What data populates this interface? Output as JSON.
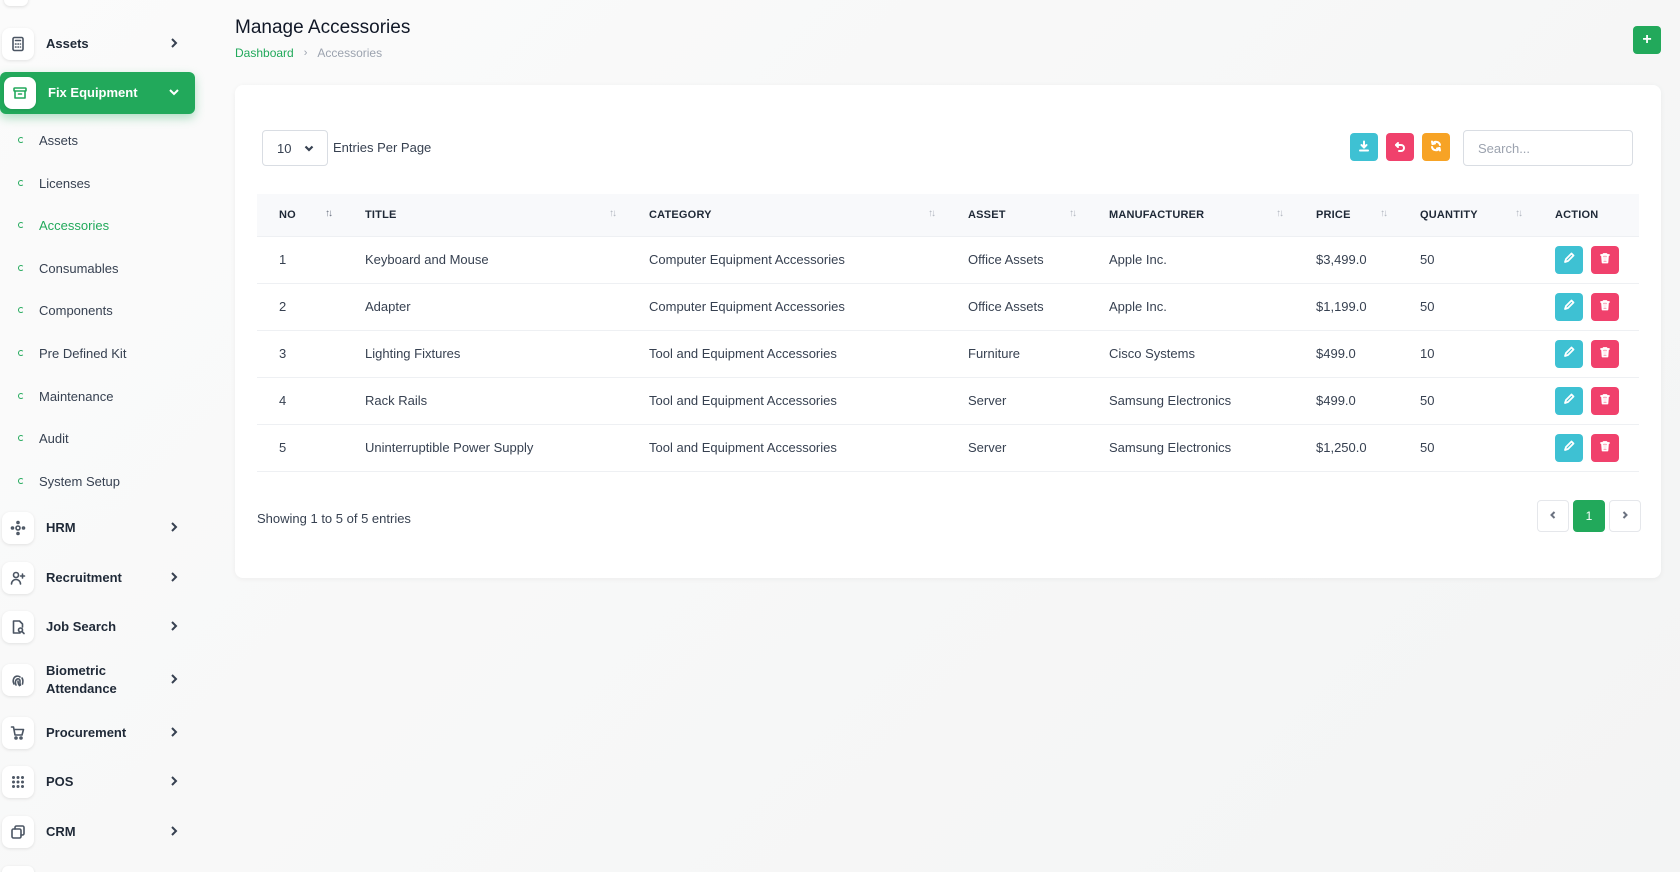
{
  "sidebar": {
    "groups": [
      {
        "label": "Assets",
        "icon": "calculator-icon"
      },
      {
        "label": "Fix Equipment",
        "icon": "archive-box-icon",
        "active": true
      }
    ],
    "sub_items": [
      {
        "label": "Assets"
      },
      {
        "label": "Licenses"
      },
      {
        "label": "Accessories",
        "current": true
      },
      {
        "label": "Consumables"
      },
      {
        "label": "Components"
      },
      {
        "label": "Pre Defined Kit"
      },
      {
        "label": "Maintenance"
      },
      {
        "label": "Audit"
      },
      {
        "label": "System Setup"
      }
    ],
    "lower_groups": [
      {
        "label": "HRM",
        "icon": "hrm-icon"
      },
      {
        "label": "Recruitment",
        "icon": "user-plus-icon"
      },
      {
        "label": "Job Search",
        "icon": "job-search-icon"
      },
      {
        "label": "Biometric Attendance",
        "line1": "Biometric",
        "line2": "Attendance",
        "icon": "fingerprint-icon"
      },
      {
        "label": "Procurement",
        "icon": "cart-icon"
      },
      {
        "label": "POS",
        "icon": "grid-dots-icon"
      },
      {
        "label": "CRM",
        "icon": "crm-icon"
      }
    ]
  },
  "header": {
    "title": "Manage Accessories",
    "breadcrumb": {
      "link": "Dashboard",
      "current": "Accessories"
    },
    "add_label": "+"
  },
  "toolbar": {
    "entries_value": "10",
    "entries_label": "Entries Per Page",
    "search_placeholder": "Search...",
    "colors": {
      "export": "#3ec1d3",
      "undo": "#f0416c",
      "refresh": "#f7a325"
    }
  },
  "table": {
    "columns": [
      "NO",
      "TITLE",
      "CATEGORY",
      "ASSET",
      "MANUFACTURER",
      "PRICE",
      "QUANTITY",
      "ACTION"
    ],
    "rows": [
      {
        "no": "1",
        "title": "Keyboard and Mouse",
        "category": "Computer Equipment Accessories",
        "asset": "Office Assets",
        "manufacturer": "Apple Inc.",
        "price": "$3,499.0",
        "quantity": "50"
      },
      {
        "no": "2",
        "title": "Adapter",
        "category": "Computer Equipment Accessories",
        "asset": "Office Assets",
        "manufacturer": "Apple Inc.",
        "price": "$1,199.0",
        "quantity": "50"
      },
      {
        "no": "3",
        "title": "Lighting Fixtures",
        "category": "Tool and Equipment Accessories",
        "asset": "Furniture",
        "manufacturer": "Cisco Systems",
        "price": "$499.0",
        "quantity": "10"
      },
      {
        "no": "4",
        "title": "Rack Rails",
        "category": "Tool and Equipment Accessories",
        "asset": "Server",
        "manufacturer": "Samsung Electronics",
        "price": "$499.0",
        "quantity": "50"
      },
      {
        "no": "5",
        "title": "Uninterruptible Power Supply",
        "category": "Tool and Equipment Accessories",
        "asset": "Server",
        "manufacturer": "Samsung Electronics",
        "price": "$1,250.0",
        "quantity": "50"
      }
    ]
  },
  "footer": {
    "showing": "Showing 1 to 5 of 5 entries",
    "current_page": "1"
  },
  "theme": {
    "accent": "#22a95b"
  }
}
